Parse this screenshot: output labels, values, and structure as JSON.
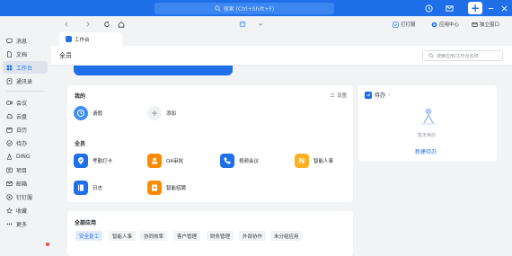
{
  "titlebar": {
    "search_placeholder": "搜索 (Ctrl+Shift+F)",
    "icons": [
      "history-icon",
      "mail-icon",
      "add-icon",
      "minimize-icon",
      "maximize-icon",
      "close-icon"
    ]
  },
  "sidebar": {
    "items": [
      {
        "label": "消息",
        "icon": "chat-icon"
      },
      {
        "label": "文档",
        "icon": "doc-icon"
      },
      {
        "label": "工作台",
        "icon": "grid-icon",
        "active": true
      },
      {
        "label": "通讯录",
        "icon": "contacts-icon"
      },
      {
        "label": "会议",
        "icon": "video-icon"
      },
      {
        "label": "云盘",
        "icon": "cloud-icon"
      },
      {
        "label": "日历",
        "icon": "calendar-icon"
      },
      {
        "label": "待办",
        "icon": "todo-icon"
      },
      {
        "label": "DING",
        "icon": "ding-icon"
      },
      {
        "label": "项目",
        "icon": "project-icon"
      },
      {
        "label": "邮箱",
        "icon": "mailbox-icon"
      },
      {
        "label": "钉钉服",
        "icon": "service-icon"
      },
      {
        "label": "收藏",
        "icon": "star-icon"
      },
      {
        "label": "更多",
        "icon": "more-icon"
      }
    ]
  },
  "navbar": {
    "punch_label": "打打服",
    "app_center_label": "应用中心",
    "standalone_label": "独立窗口"
  },
  "tab": {
    "label": "工作台"
  },
  "header": {
    "title": "全员",
    "search_placeholder": "搜索应用/工作台名称"
  },
  "mine": {
    "title": "我的",
    "settings_label": "设置",
    "apps": [
      {
        "label": "请假",
        "icon": "clock-icon",
        "color": "#3d8ef5"
      },
      {
        "label": "添加",
        "icon": "plus-icon",
        "color": "#f0f1f3"
      }
    ]
  },
  "all_staff": {
    "title": "全员",
    "apps": [
      {
        "label": "考勤打卡",
        "icon": "location-check-icon",
        "color": "#1e6fe8"
      },
      {
        "label": "OA审批",
        "icon": "approval-icon",
        "color": "#ff8a00"
      },
      {
        "label": "视频会议",
        "icon": "phone-icon",
        "color": "#1e6fe8"
      },
      {
        "label": "智能人事",
        "icon": "hr-icon",
        "color": "#ffb020"
      },
      {
        "label": "日志",
        "icon": "log-icon",
        "color": "#1e6fe8"
      },
      {
        "label": "智能招聘",
        "icon": "recruit-icon",
        "color": "#ff8a00"
      }
    ]
  },
  "todo": {
    "title": "待办",
    "empty_text": "暂无待办",
    "new_label": "新建待办"
  },
  "all_apps": {
    "title": "全部应用",
    "tags": [
      {
        "label": "安全复工",
        "active": true
      },
      {
        "label": "智能人事"
      },
      {
        "label": "协同效率"
      },
      {
        "label": "客户管理"
      },
      {
        "label": "财务管理"
      },
      {
        "label": "外部协作"
      },
      {
        "label": "未分组应用"
      }
    ]
  }
}
